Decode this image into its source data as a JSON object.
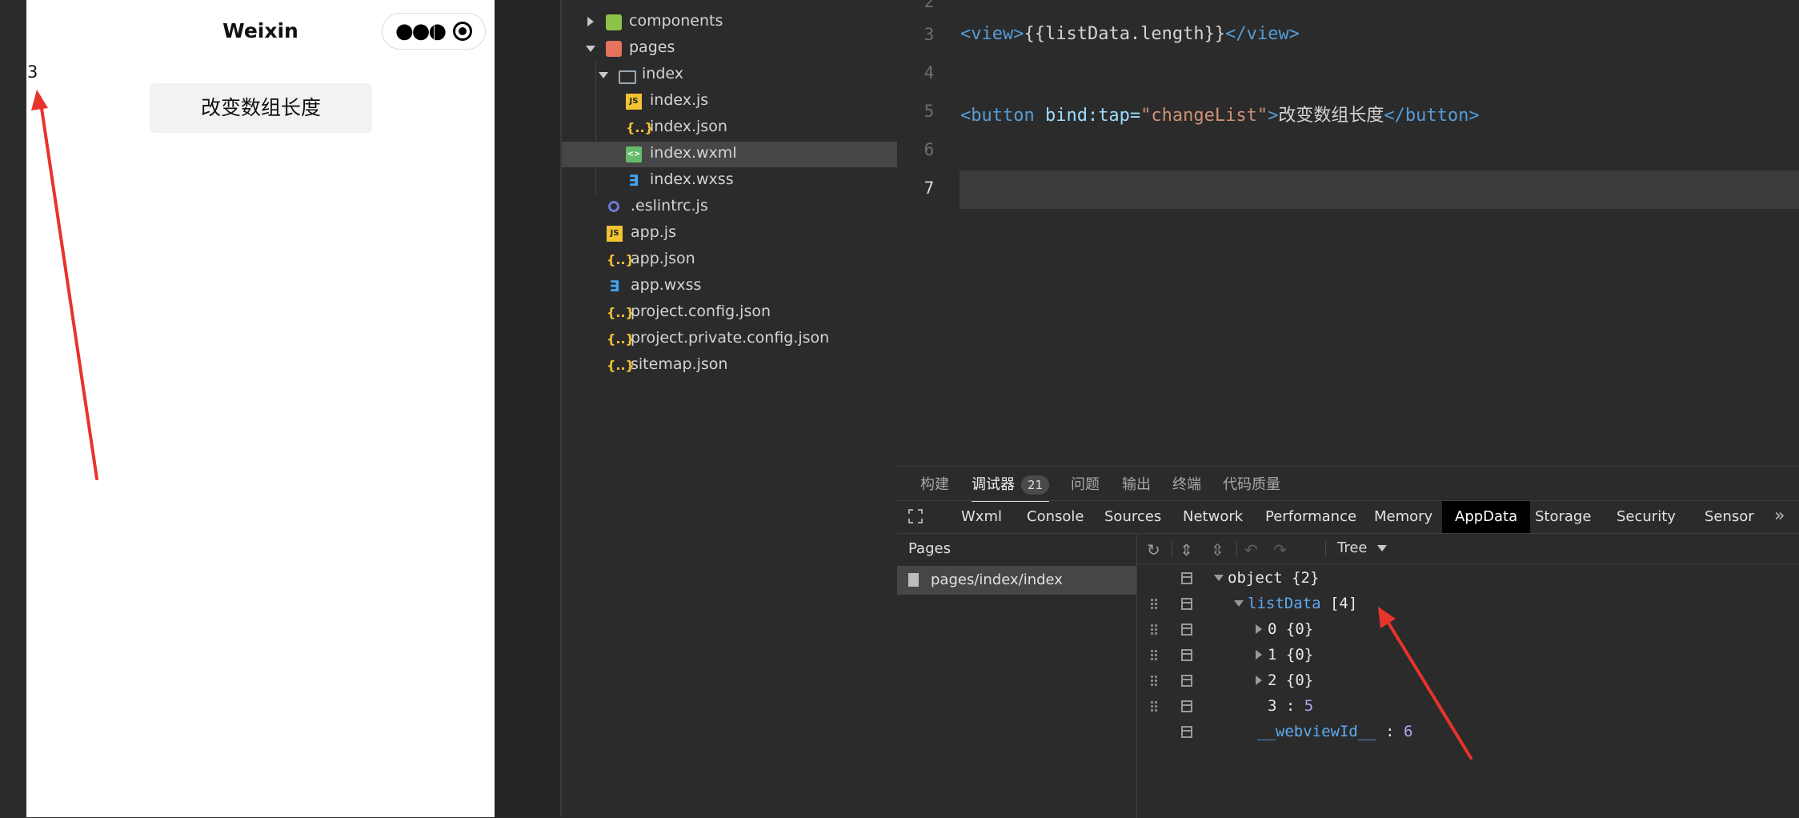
{
  "simulator": {
    "nav_title": "Weixin",
    "view_text": "3",
    "button_label": "改变数组长度"
  },
  "explorer": {
    "items": [
      {
        "label": "components",
        "icon": "folder-icon"
      },
      {
        "label": "pages",
        "icon": "folder-icon"
      },
      {
        "label": "index",
        "icon": "folder-open-icon"
      },
      {
        "label": "index.js",
        "icon": "js-file-icon"
      },
      {
        "label": "index.json",
        "icon": "json-file-icon"
      },
      {
        "label": "index.wxml",
        "icon": "wxml-file-icon"
      },
      {
        "label": "index.wxss",
        "icon": "wxss-file-icon"
      },
      {
        "label": ".eslintrc.js",
        "icon": "eslint-file-icon"
      },
      {
        "label": "app.js",
        "icon": "js-file-icon"
      },
      {
        "label": "app.json",
        "icon": "json-file-icon"
      },
      {
        "label": "app.wxss",
        "icon": "wxss-file-icon"
      },
      {
        "label": "project.config.json",
        "icon": "json-file-icon"
      },
      {
        "label": "project.private.config.json",
        "icon": "json-file-icon"
      },
      {
        "label": "sitemap.json",
        "icon": "json-file-icon"
      }
    ],
    "selected": "index.wxml"
  },
  "editor": {
    "lines": [
      {
        "num": "2",
        "text": ""
      },
      {
        "num": "3",
        "tag_open": "<view>",
        "expr": "{{listData.length}}",
        "tag_close": "</view>"
      },
      {
        "num": "4",
        "text": ""
      },
      {
        "num": "5",
        "tag_open": "<button",
        "attr": " bind:tap=",
        "str": "\"changeList\"",
        "tag_gt": ">",
        "text": "改变数组长度",
        "tag_close": "</button>"
      },
      {
        "num": "6",
        "text": ""
      },
      {
        "num": "7",
        "text": ""
      }
    ],
    "current_line": "7"
  },
  "devtools": {
    "top_tabs": [
      "构建",
      "调试器",
      "问题",
      "输出",
      "终端",
      "代码质量"
    ],
    "debugger_badge": "21",
    "panel_tabs": [
      "Wxml",
      "Console",
      "Sources",
      "Network",
      "Performance",
      "Memory",
      "AppData",
      "Storage",
      "Security",
      "Sensor"
    ],
    "active_panel_tab": "AppData",
    "more_tabs_glyph": "»",
    "pages_title": "Pages",
    "pages_item": "pages/index/index",
    "view_mode": "Tree",
    "tree": {
      "root": "object {2}",
      "listData_key": "listData",
      "listData_val": "[4]",
      "items": [
        {
          "key": "0",
          "val": "{0}"
        },
        {
          "key": "1",
          "val": "{0}"
        },
        {
          "key": "2",
          "val": "{0}"
        }
      ],
      "item3_key": "3",
      "item3_val": "5",
      "webview_key": "__webviewId__",
      "webview_val": "6",
      "colon": " : "
    }
  },
  "colors": {
    "accent_arrow": "#e8332c",
    "active_tab_bg": "#000000",
    "editor_tag": "#569cd6",
    "editor_string": "#ce9178"
  }
}
